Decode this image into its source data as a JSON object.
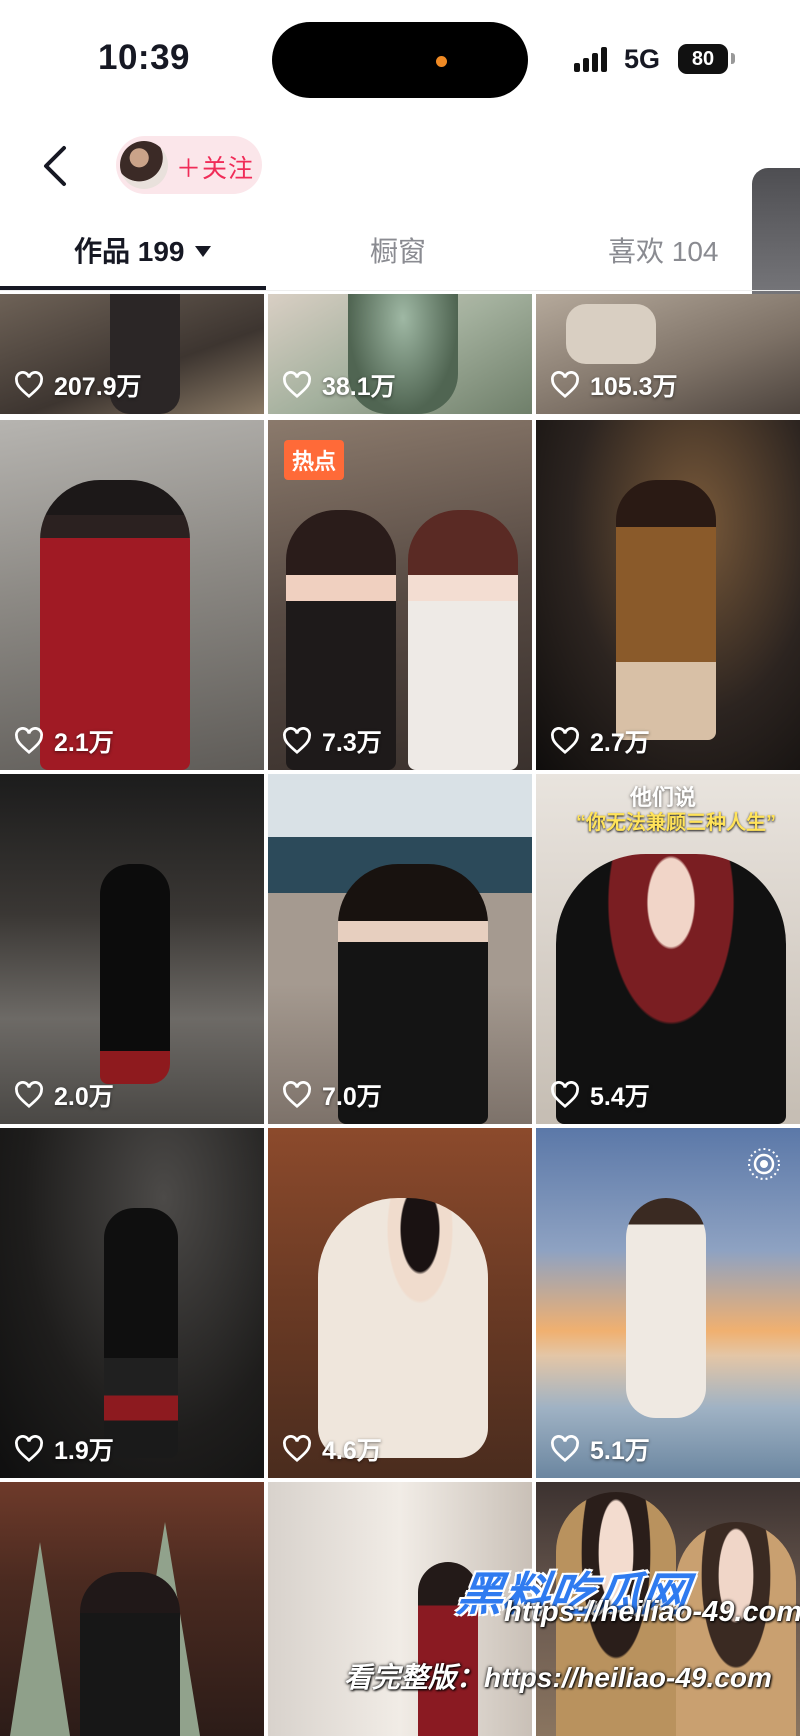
{
  "status_bar": {
    "time": "10:39",
    "network": "5G",
    "battery": "80"
  },
  "header": {
    "follow_label": "＋关注"
  },
  "tabs": [
    {
      "label": "作品 199",
      "active": true
    },
    {
      "label": "橱窗",
      "active": false
    },
    {
      "label": "喜欢 104",
      "active": false
    }
  ],
  "colors": {
    "accent": "#f02c58",
    "hot_badge": "#ff6a38",
    "watermark_blue": "#2f7bf0"
  },
  "grid": {
    "items": [
      {
        "likes": "207.9万"
      },
      {
        "likes": "38.1万"
      },
      {
        "likes": "105.3万"
      },
      {
        "likes": "2.1万"
      },
      {
        "likes": "7.3万",
        "badge": "热点"
      },
      {
        "likes": "2.7万"
      },
      {
        "likes": "2.0万"
      },
      {
        "likes": "7.0万"
      },
      {
        "likes": "5.4万",
        "caption": "他们说",
        "caption_sub": "“你无法兼顾三种人生”"
      },
      {
        "likes": "1.9万"
      },
      {
        "likes": "4.6万"
      },
      {
        "likes": "5.1万",
        "icon": "live-icon"
      },
      {
        "likes": ""
      },
      {
        "likes": ""
      },
      {
        "likes": ""
      }
    ]
  },
  "watermark": {
    "logo": "黑料吃瓜网",
    "url": "https://heiliao-49.com",
    "prefix": "看完整版："
  }
}
